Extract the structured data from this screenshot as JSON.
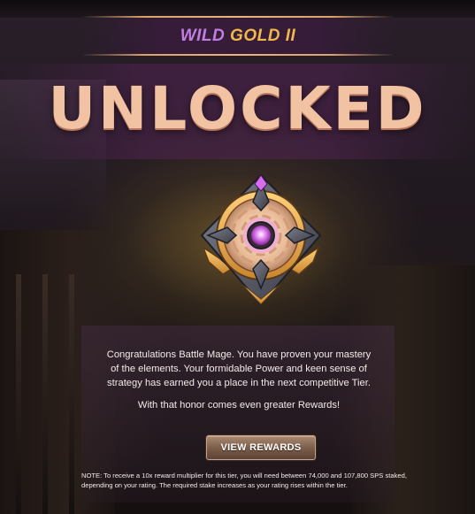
{
  "header": {
    "tier_word1": "WILD",
    "tier_word2": "GOLD II"
  },
  "status_title": "UNLOCKED",
  "message": {
    "paragraph1": "Congratulations Battle Mage. You have proven your mastery of the elements. Your formidable Power and keen sense of strategy has earned you a place in the next competitive Tier.",
    "paragraph2": "With that honor comes even greater Rewards!"
  },
  "actions": {
    "view_rewards_label": "VIEW REWARDS"
  },
  "note": "NOTE: To receive a 10x reward multiplier for this tier, you will need between 74,000 and 107,800 SPS staked, depending on your rating. The required stake increases as your rating rises within the tier.",
  "colors": {
    "wild": "#c07fe0",
    "gold": "#f0b84c",
    "unlocked": "#f2c3a2",
    "badge_gem": "#e070f0"
  },
  "icons": {
    "badge": "gold-tier-emblem-icon"
  }
}
